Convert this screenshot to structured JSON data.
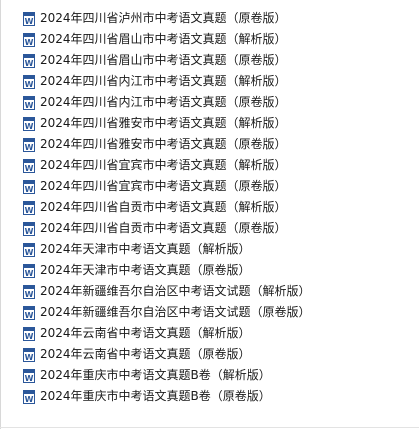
{
  "files": [
    {
      "name": "2024年四川省泸州市中考语文真题（原卷版）",
      "icon": "word-doc-icon"
    },
    {
      "name": "2024年四川省眉山市中考语文真题（解析版）",
      "icon": "word-doc-icon"
    },
    {
      "name": "2024年四川省眉山市中考语文真题（原卷版）",
      "icon": "word-doc-icon"
    },
    {
      "name": "2024年四川省内江市中考语文真题（解析版）",
      "icon": "word-doc-icon"
    },
    {
      "name": "2024年四川省内江市中考语文真题（原卷版）",
      "icon": "word-doc-icon"
    },
    {
      "name": "2024年四川省雅安市中考语文真题（解析版）",
      "icon": "word-doc-icon"
    },
    {
      "name": "2024年四川省雅安市中考语文真题（原卷版）",
      "icon": "word-doc-icon"
    },
    {
      "name": "2024年四川省宜宾市中考语文真题（解析版）",
      "icon": "word-doc-icon"
    },
    {
      "name": "2024年四川省宜宾市中考语文真题（原卷版）",
      "icon": "word-doc-icon"
    },
    {
      "name": "2024年四川省自贡市中考语文真题（解析版）",
      "icon": "word-doc-icon"
    },
    {
      "name": "2024年四川省自贡市中考语文真题（原卷版）",
      "icon": "word-doc-icon"
    },
    {
      "name": "2024年天津市中考语文真题（解析版）",
      "icon": "word-doc-icon"
    },
    {
      "name": "2024年天津市中考语文真题（原卷版）",
      "icon": "word-doc-icon"
    },
    {
      "name": "2024年新疆维吾尔自治区中考语文试题（解析版）",
      "icon": "word-doc-icon"
    },
    {
      "name": "2024年新疆维吾尔自治区中考语文试题（原卷版）",
      "icon": "word-doc-icon"
    },
    {
      "name": "2024年云南省中考语文真题（解析版）",
      "icon": "word-doc-icon"
    },
    {
      "name": "2024年云南省中考语文真题（原卷版）",
      "icon": "word-doc-icon"
    },
    {
      "name": "2024年重庆市中考语文真题B卷（解析版）",
      "icon": "word-doc-icon"
    },
    {
      "name": "2024年重庆市中考语文真题B卷（原卷版）",
      "icon": "word-doc-icon"
    }
  ],
  "colors": {
    "word_blue": "#2b579a",
    "word_blue_light": "#41a5ee",
    "text": "#1a1a1a"
  }
}
